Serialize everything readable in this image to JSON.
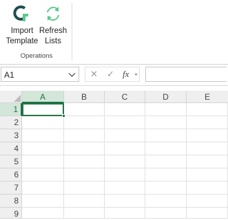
{
  "ribbon": {
    "import_label_1": "Import",
    "import_label_2": "Template",
    "refresh_label_1": "Refresh",
    "refresh_label_2": "Lists",
    "group_label": "Operations"
  },
  "formula_bar": {
    "name_box": "A1",
    "cancel_glyph": "✕",
    "enter_glyph": "✓",
    "fx_glyph": "fx",
    "formula_value": ""
  },
  "sheet": {
    "columns": [
      "A",
      "B",
      "C",
      "D",
      "E"
    ],
    "rows": [
      "1",
      "2",
      "3",
      "4",
      "5",
      "6",
      "7",
      "8",
      "9"
    ],
    "active_cell": "A1"
  },
  "colors": {
    "accent": "#217346",
    "icon_dark": "#1f4e4e",
    "icon_green": "#5cc98a"
  },
  "icons": {
    "import": "import-template-icon",
    "refresh": "refresh-icon"
  }
}
